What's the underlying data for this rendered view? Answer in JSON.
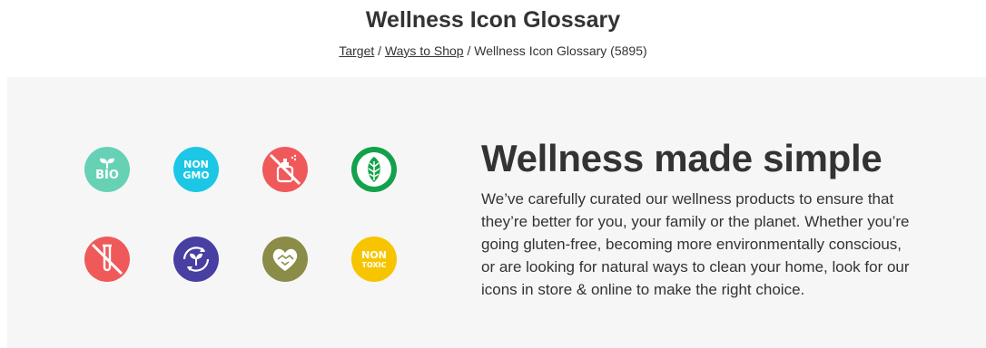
{
  "header": {
    "title": "Wellness Icon Glossary",
    "breadcrumb": [
      {
        "label": "Target"
      },
      {
        "label": "Ways to Shop"
      },
      {
        "label": "Wellness Icon Glossary (5895)"
      }
    ],
    "separator": "/"
  },
  "panel": {
    "headline": "Wellness made simple",
    "body": "We’ve carefully curated our wellness products to ensure that they’re better for you, your family or the planet. Whether you’re going gluten-free, becoming more environmentally conscious, or are looking for natural ways to clean your home, look for our icons in store & online to make the right choice.",
    "icons": [
      {
        "name": "bio-icon",
        "text_lines": [
          "BIO"
        ],
        "color": "#67d1b6"
      },
      {
        "name": "non-gmo-icon",
        "text_lines": [
          "NON",
          "GMO"
        ],
        "color": "#1cc7e5"
      },
      {
        "name": "no-fragrance-icon",
        "color": "#f0595a"
      },
      {
        "name": "leaf-icon",
        "color": "#14a14b"
      },
      {
        "name": "no-test-tube-icon",
        "color": "#f0595a"
      },
      {
        "name": "sustainable-cycle-icon",
        "color": "#473fa1"
      },
      {
        "name": "heart-handshake-icon",
        "color": "#8b8c48"
      },
      {
        "name": "non-toxic-icon",
        "text_lines": [
          "NON",
          "TOXIC"
        ],
        "color": "#f7c500"
      }
    ]
  }
}
